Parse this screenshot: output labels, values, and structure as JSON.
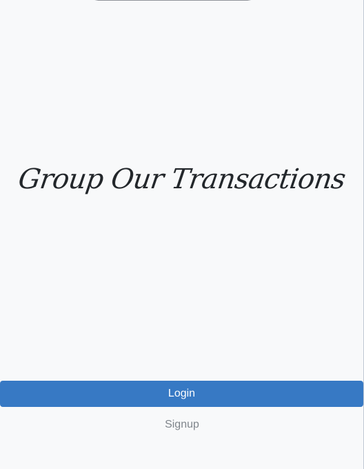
{
  "screen": {
    "title": "Group Our Transactions"
  },
  "actions": {
    "login_label": "Login",
    "signup_label": "Signup"
  },
  "colors": {
    "background": "#f8f9fa",
    "primary": "#3779c4",
    "title_text": "#23272b",
    "secondary_text": "#7f858b"
  }
}
